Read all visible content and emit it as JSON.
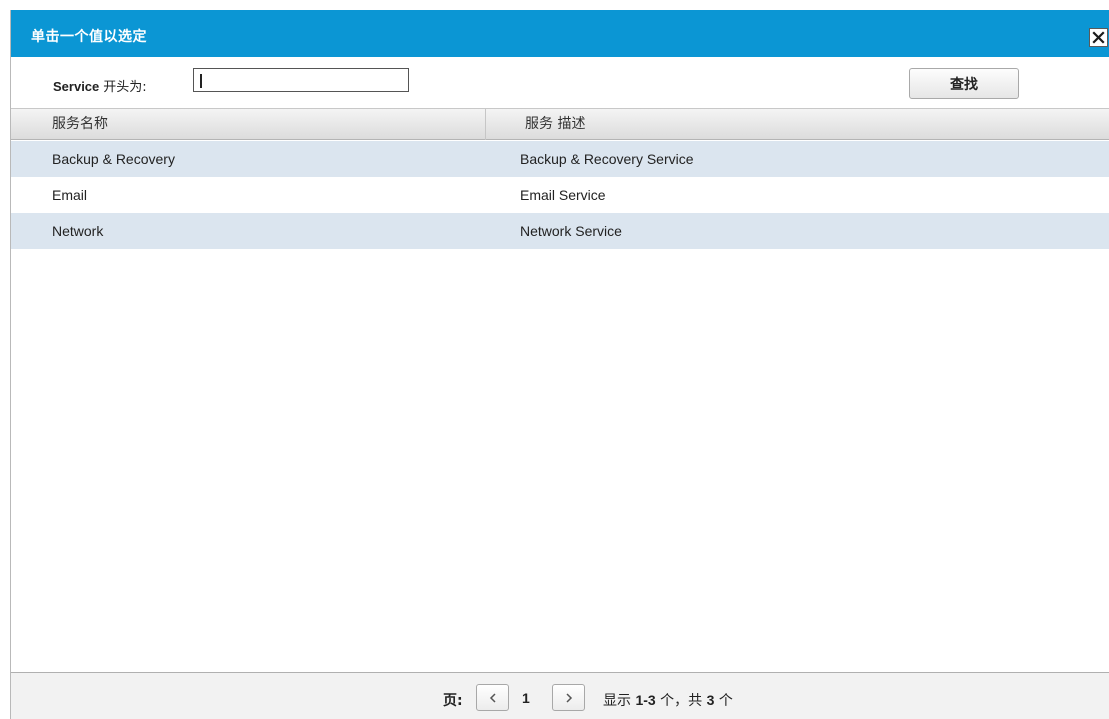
{
  "dialog": {
    "title": "单击一个值以选定",
    "close_icon": "close-icon"
  },
  "filter": {
    "label_service": "Service",
    "label_suffix": "开头为:",
    "input_value": "",
    "search_button": "查找"
  },
  "grid": {
    "columns": [
      "服务名称",
      "服务 描述"
    ],
    "rows": [
      {
        "name": "Backup & Recovery",
        "description": "Backup & Recovery Service"
      },
      {
        "name": "Email",
        "description": "Email Service"
      },
      {
        "name": "Network",
        "description": "Network Service"
      }
    ]
  },
  "pagination": {
    "label": "页:",
    "current_page": "1",
    "prev_icon": "chevron-left-icon",
    "next_icon": "chevron-right-icon",
    "info_prefix": "显示",
    "info_range": "1-3",
    "info_middle": "个，共",
    "info_total": "3",
    "info_suffix": "个"
  },
  "colors": {
    "titlebar": "#0b96d4",
    "row_alt": "#dbe5ef"
  }
}
